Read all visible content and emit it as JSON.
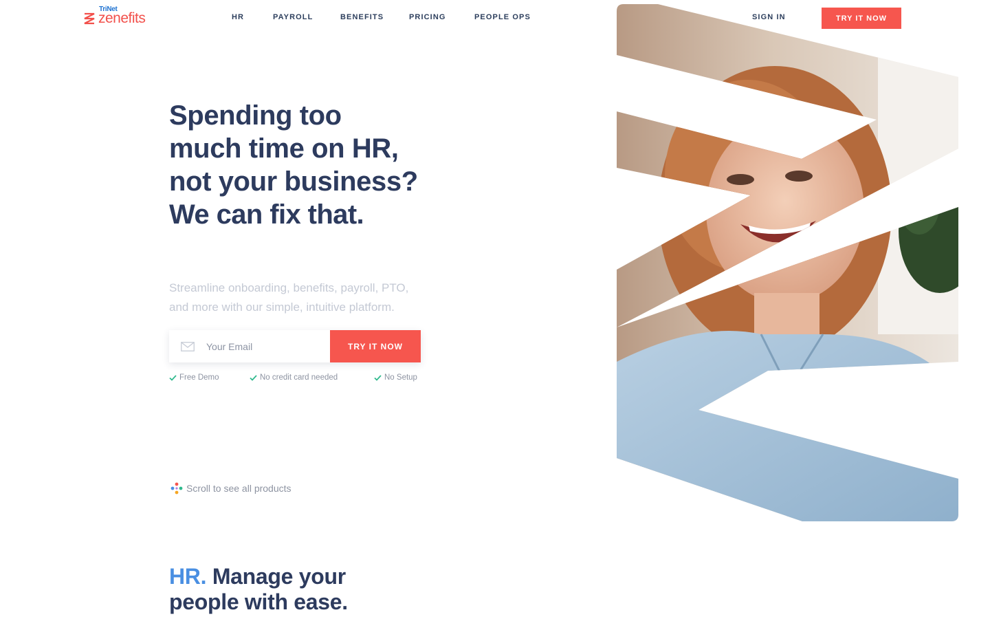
{
  "brand": {
    "parent_name": "TriNet",
    "product_name": "zenefits",
    "accent_color": "#f6564e",
    "blue_color": "#4a8fe2",
    "navy_color": "#2d3b5e"
  },
  "nav": {
    "items": [
      "HR",
      "PAYROLL",
      "BENEFITS",
      "PRICING",
      "PEOPLE OPS"
    ],
    "sign_in": "SIGN IN",
    "cta": "TRY IT NOW"
  },
  "hero": {
    "headline_lines": [
      "Spending too",
      "much time on HR,",
      "not your business?"
    ],
    "headline_strong": "We can fix that.",
    "subhead_lines": [
      "Streamline onboarding, benefits, payroll, PTO,",
      "and more with our simple, intuitive platform."
    ],
    "email_placeholder": "Your Email",
    "email_icon": "envelope-icon",
    "signup_button": "TRY IT NOW",
    "perks": [
      "Free Demo",
      "No credit card needed",
      "No Setup"
    ],
    "perk_icon": "checkmark-icon",
    "scroll_hint": "Scroll to see all products",
    "image_alt_icon": "smiling-woman-photo"
  },
  "hr_section": {
    "accent": "HR.",
    "title_rest": "Manage your",
    "title_line2": "people with ease."
  }
}
